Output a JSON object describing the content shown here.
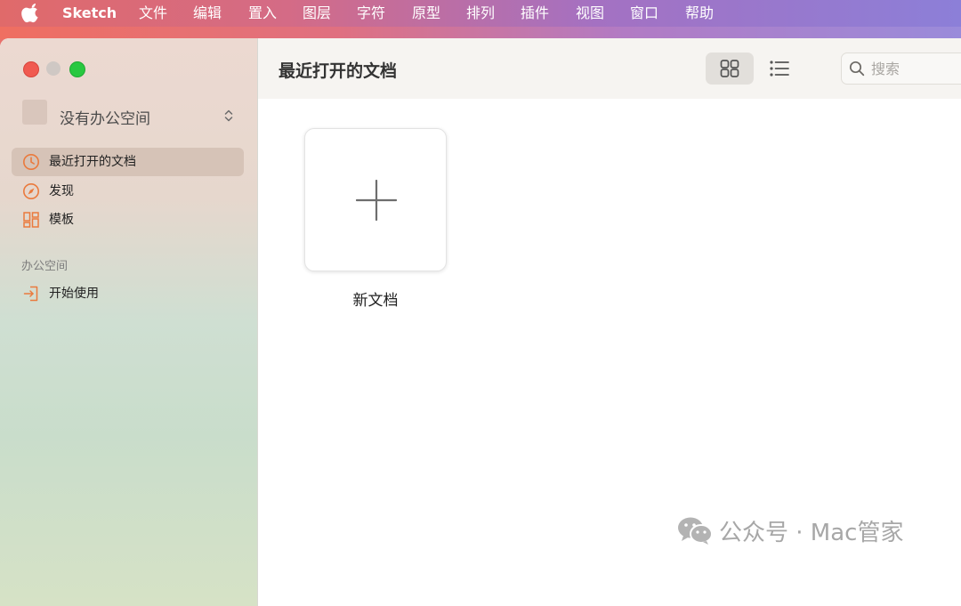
{
  "menubar": {
    "apple_icon": "apple-logo-icon",
    "app_name": "Sketch",
    "items": [
      "文件",
      "编辑",
      "置入",
      "图层",
      "字符",
      "原型",
      "排列",
      "插件",
      "视图",
      "窗口",
      "帮助"
    ]
  },
  "sidebar": {
    "workspace_label": "没有办公空间",
    "nav_items": [
      {
        "label": "最近打开的文档",
        "icon": "clock-icon",
        "selected": true
      },
      {
        "label": "发现",
        "icon": "compass-icon",
        "selected": false
      },
      {
        "label": "模板",
        "icon": "templates-icon",
        "selected": false
      }
    ],
    "section_header": "办公空间",
    "section_items": [
      {
        "label": "开始使用",
        "icon": "sign-in-icon"
      }
    ]
  },
  "toolbar": {
    "title": "最近打开的文档",
    "search_placeholder": "搜索"
  },
  "content": {
    "new_document_label": "新文档"
  },
  "watermark": {
    "text": "公众号 · Mac管家",
    "icon": "wechat-icon"
  },
  "colors": {
    "accent_orange": "#ea7a3d",
    "selected_row": "#d6c3b7",
    "close_red": "#f05a50",
    "zoom_green": "#28c840"
  }
}
